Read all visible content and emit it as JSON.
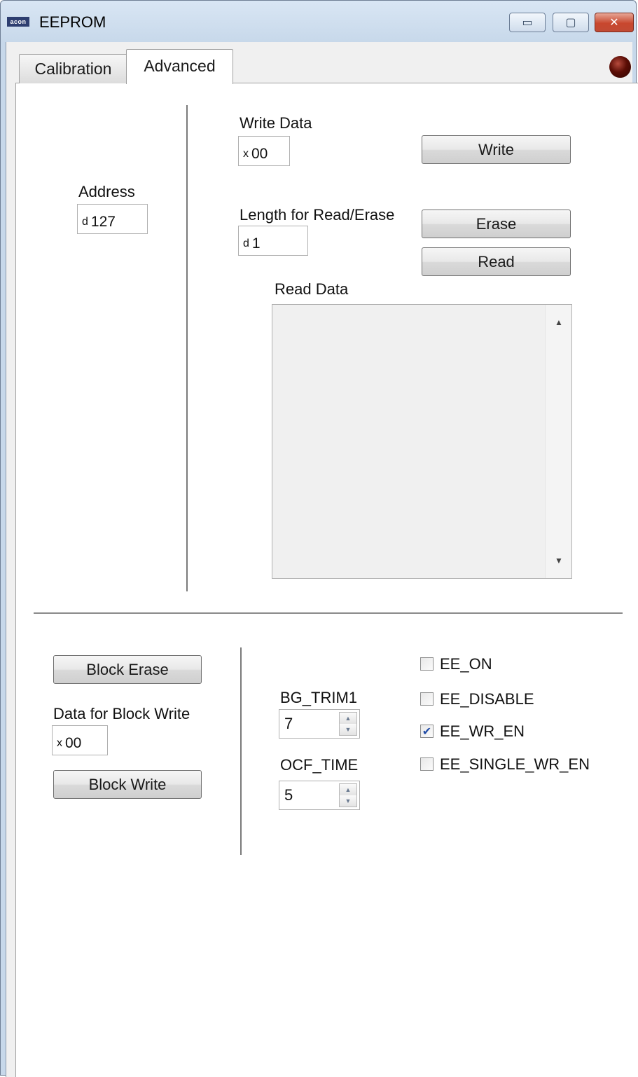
{
  "window": {
    "logo_text": "acon",
    "title": "EEPROM",
    "controls": {
      "minimize": "▭",
      "maximize": "▢",
      "close": "✕"
    }
  },
  "tabs": [
    {
      "label": "Calibration",
      "active": false
    },
    {
      "label": "Advanced",
      "active": true
    }
  ],
  "status_indicator": {
    "color": "#5b0d05"
  },
  "address": {
    "label": "Address",
    "prefix": "d",
    "value": "127"
  },
  "write_data": {
    "label": "Write Data",
    "prefix": "x",
    "value": "00",
    "button": "Write"
  },
  "length": {
    "label": "Length for Read/Erase",
    "prefix": "d",
    "value": "1"
  },
  "erase_button": "Erase",
  "read_button": "Read",
  "read_data": {
    "label": "Read Data",
    "value": ""
  },
  "block": {
    "erase_button": "Block Erase",
    "data_label": "Data for Block Write",
    "prefix": "x",
    "value": "00",
    "write_button": "Block Write"
  },
  "spinners": {
    "bg_trim1": {
      "label": "BG_TRIM1",
      "value": "7"
    },
    "ocf_time": {
      "label": "OCF_TIME",
      "value": "5"
    }
  },
  "checkboxes": [
    {
      "label": "EE_ON",
      "checked": false
    },
    {
      "label": "EE_DISABLE",
      "checked": false
    },
    {
      "label": "EE_WR_EN",
      "checked": true
    },
    {
      "label": "EE_SINGLE_WR_EN",
      "checked": false
    }
  ],
  "check_mark": "✔",
  "icons": {
    "scroll_up": "▲",
    "scroll_down": "▼",
    "spin_up": "▲",
    "spin_down": "▼"
  }
}
